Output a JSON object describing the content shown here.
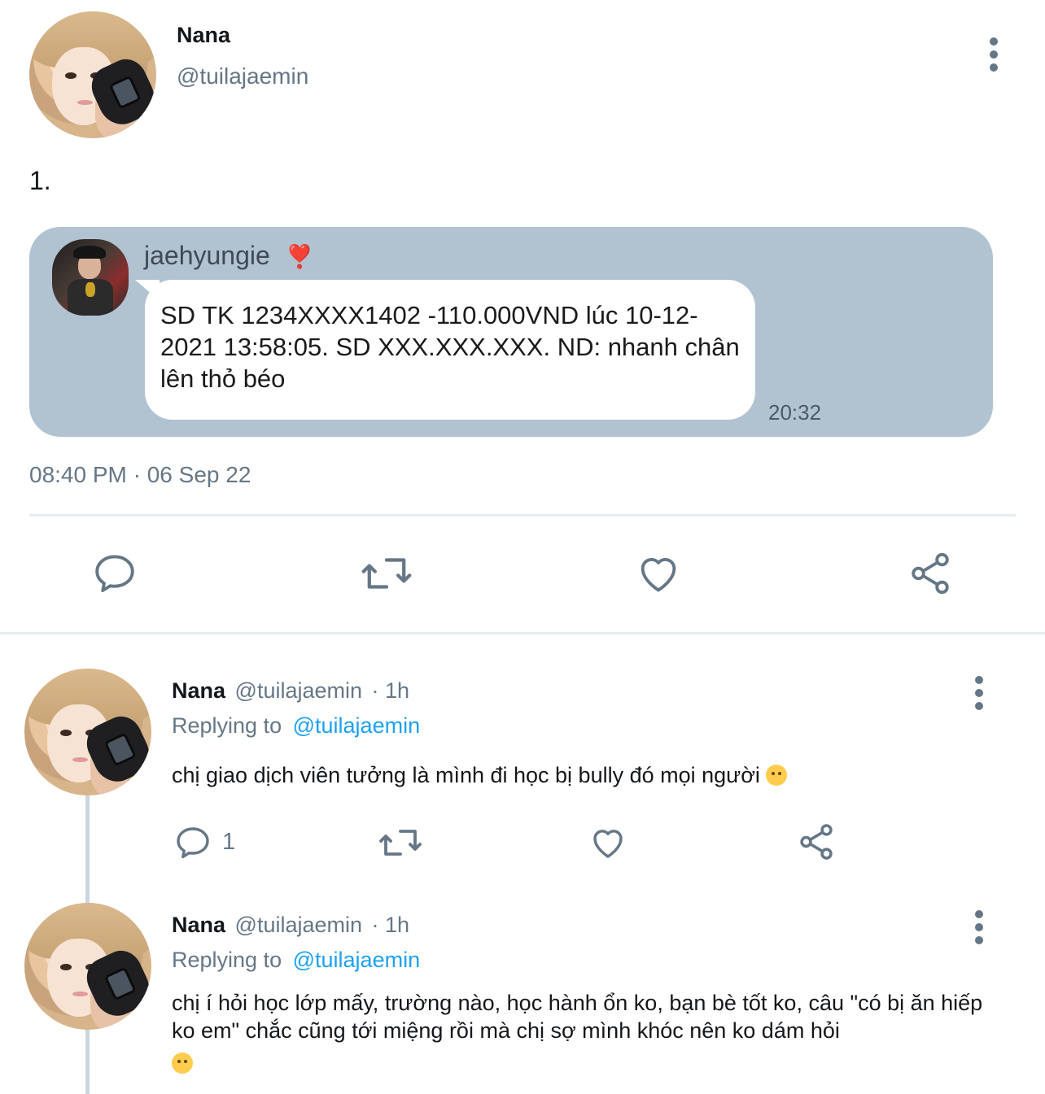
{
  "post": {
    "author_name": "Nana",
    "author_handle": "@tuilajaemin",
    "text": "1.",
    "timestamp": "08:40 PM · 06 Sep 22",
    "embedded_message": {
      "sender_name": "jaehyungie",
      "sender_emoji": "❣️",
      "body": "SD TK 1234XXXX1402 -110.000VND lúc 10-12-2021 13:58:05. SD XXX.XXX.XXX. ND: nhanh chân lên thỏ béo",
      "time": "20:32"
    },
    "actions": [
      "reply-icon",
      "retweet-icon",
      "like-icon",
      "share-icon"
    ]
  },
  "replies": [
    {
      "author_name": "Nana",
      "author_handle": "@tuilajaemin",
      "age": "· 1h",
      "replying_prefix": "Replying to",
      "replying_to": "@tuilajaemin",
      "text": "chị giao dịch viên tưởng là mình đi học bị bully đó mọi người",
      "emoji": "😢",
      "reply_count": "1"
    },
    {
      "author_name": "Nana",
      "author_handle": "@tuilajaemin",
      "age": "· 1h",
      "replying_prefix": "Replying to",
      "replying_to": "@tuilajaemin",
      "text": "chị í hỏi học lớp mấy, trường nào, học hành ổn ko, bạn bè tốt ko, câu \"có bị ăn hiếp ko em\" chắc cũng tới miệng rồi mà chị sợ mình khóc nên ko dám hỏi",
      "emoji": "😞"
    }
  ],
  "colors": {
    "accent": "#1da1f2",
    "muted": "#657786",
    "message_card": "#b1c2d1"
  }
}
